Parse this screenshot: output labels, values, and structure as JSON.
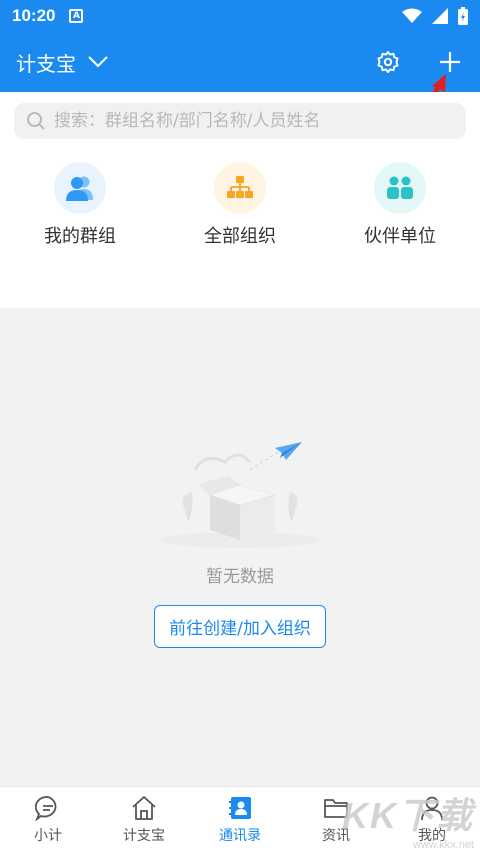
{
  "status": {
    "time": "10:20",
    "notif_badge": "A"
  },
  "header": {
    "title": "计支宝",
    "dropdown_icon": "chevron-down-icon",
    "settings_icon": "gear-icon",
    "add_icon": "plus-icon"
  },
  "search": {
    "placeholder": "搜索：群组名称/部门名称/人员姓名"
  },
  "quick_actions": [
    {
      "label": "我的群组",
      "icon": "group-icon",
      "color": "#2f9af5",
      "bg": "#e8f3fe"
    },
    {
      "label": "全部组织",
      "icon": "org-chart-icon",
      "color": "#f5a623",
      "bg": "#fff4e2"
    },
    {
      "label": "伙伴单位",
      "icon": "partners-icon",
      "color": "#2bc2c6",
      "bg": "#e3f7f7"
    }
  ],
  "empty": {
    "text": "暂无数据",
    "button": "前往创建/加入组织"
  },
  "tabs": [
    {
      "label": "小计",
      "icon": "chat-bubble-icon",
      "active": false
    },
    {
      "label": "计支宝",
      "icon": "home-icon",
      "active": false
    },
    {
      "label": "通讯录",
      "icon": "contacts-icon",
      "active": true
    },
    {
      "label": "资讯",
      "icon": "folder-icon",
      "active": false
    },
    {
      "label": "我的",
      "icon": "person-icon",
      "active": false
    }
  ],
  "watermark": {
    "main": "KK下载",
    "sub": "www.kkx.net"
  },
  "colors": {
    "primary": "#1a8af0",
    "annotation_arrow": "#e0201c"
  }
}
